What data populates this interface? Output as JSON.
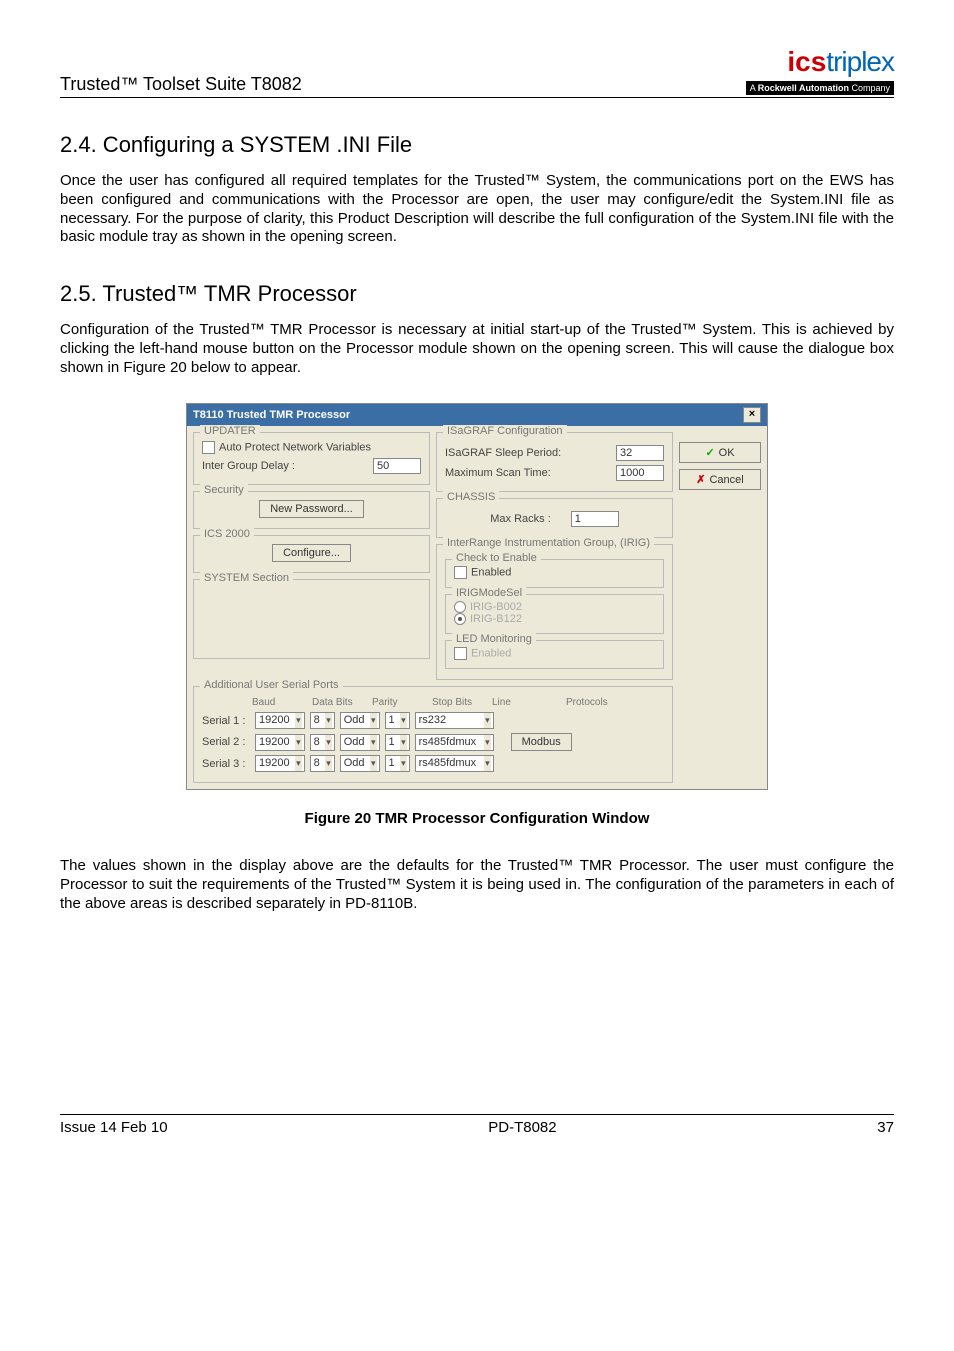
{
  "header": {
    "left": "Trusted™ Toolset Suite T8082"
  },
  "logo": {
    "ics": "ics",
    "triplex": "triplex",
    "sub_prefix": "A ",
    "sub_brand": "Rockwell Automation",
    "sub_suffix": " Company"
  },
  "section_24": {
    "title": "2.4. Configuring a SYSTEM .INI File",
    "para": "Once the user has configured all required templates for the Trusted™ System, the communications port on the EWS has been configured and communications with the Processor are open, the user may configure/edit the System.INI file as necessary.  For the purpose of clarity, this Product Description will describe the full configuration of the System.INI file with the basic module tray as shown in the opening screen."
  },
  "section_25": {
    "title": "2.5. Trusted™ TMR Processor",
    "para": "Configuration of the Trusted™ TMR Processor is necessary at initial start-up of the Trusted™ System. This is achieved by clicking the left-hand mouse button on the Processor module shown on the opening screen.  This will cause the dialogue box shown in Figure 20 below to appear."
  },
  "dialog": {
    "title": "T8110 Trusted TMR Processor",
    "updater": {
      "legend": "UPDATER",
      "auto_protect": "Auto Protect Network Variables",
      "inter_group_delay_label": "Inter Group  Delay :",
      "inter_group_delay_value": "50"
    },
    "isagraf": {
      "legend": "ISaGRAF Configuration",
      "sleep_label": "ISaGRAF Sleep Period:",
      "sleep_value": "32",
      "max_scan_label": "Maximum Scan Time:",
      "max_scan_value": "1000"
    },
    "security": {
      "legend": "Security",
      "button": "New Password..."
    },
    "chassis": {
      "legend": "CHASSIS",
      "label": "Max Racks :",
      "value": "1"
    },
    "ics2000": {
      "legend": "ICS 2000",
      "button": "Configure..."
    },
    "system_section": {
      "legend": "SYSTEM Section"
    },
    "irig": {
      "legend": "InterRange Instrumentation Group, (IRIG)",
      "check_enable_legend": "Check to Enable",
      "enabled_label": "Enabled",
      "modesel_legend": "IRIGModeSel",
      "b002": "IRIG-B002",
      "b122": "IRIG-B122",
      "led_legend": "LED Monitoring",
      "led_enabled": "Enabled"
    },
    "serials": {
      "legend": "Additional User Serial Ports",
      "headers": {
        "baud": "Baud",
        "data": "Data Bits",
        "parity": "Parity",
        "stop": "Stop Bits",
        "line": "Line",
        "protocols": "Protocols"
      },
      "rows": [
        {
          "label": "Serial 1 :",
          "baud": "19200",
          "data": "8",
          "parity": "Odd",
          "stop": "1",
          "line": "rs232",
          "protocol": ""
        },
        {
          "label": "Serial 2 :",
          "baud": "19200",
          "data": "8",
          "parity": "Odd",
          "stop": "1",
          "line": "rs485fdmux",
          "protocol": "Modbus"
        },
        {
          "label": "Serial 3 :",
          "baud": "19200",
          "data": "8",
          "parity": "Odd",
          "stop": "1",
          "line": "rs485fdmux",
          "protocol": ""
        }
      ]
    },
    "buttons": {
      "ok": "OK",
      "cancel": "Cancel"
    }
  },
  "caption": "Figure 20 TMR Processor Configuration Window",
  "closing_para": "The values shown in the display above are the defaults for the Trusted™ TMR Processor.  The user must configure the Processor to suit the requirements of the Trusted™ System it is being used in.  The configuration of the parameters in each of the above areas is described separately in PD-8110B.",
  "footer": {
    "left": "Issue 14 Feb 10",
    "center": "PD-T8082",
    "right": "37"
  }
}
